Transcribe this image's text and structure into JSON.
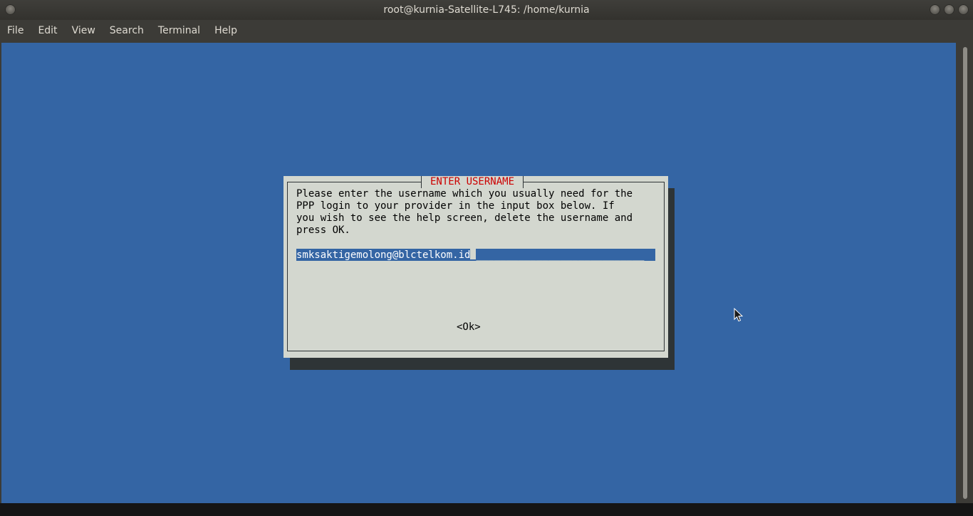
{
  "window": {
    "title": "root@kurnia-Satellite-L745: /home/kurnia"
  },
  "menubar": {
    "items": [
      "File",
      "Edit",
      "View",
      "Search",
      "Terminal",
      "Help"
    ]
  },
  "dialog": {
    "title": "ENTER USERNAME",
    "message": "Please enter the username which you usually need for the\nPPP login to your provider in the input box below. If\nyou wish to see the help screen, delete the username and\npress OK.",
    "input_value": "smksaktigemolong@blctelkom.id",
    "input_fill": "____________________________",
    "ok_label": "<Ok>"
  },
  "colors": {
    "terminal_bg": "#3465a4",
    "dialog_bg": "#d3d7cf",
    "dialog_title": "#cc0000",
    "shadow": "#2e3436"
  },
  "icons": {
    "window_menu": "window-menu-icon",
    "minimize": "minimize-icon",
    "maximize": "maximize-icon",
    "close": "close-icon",
    "pointer": "mouse-pointer-icon"
  }
}
